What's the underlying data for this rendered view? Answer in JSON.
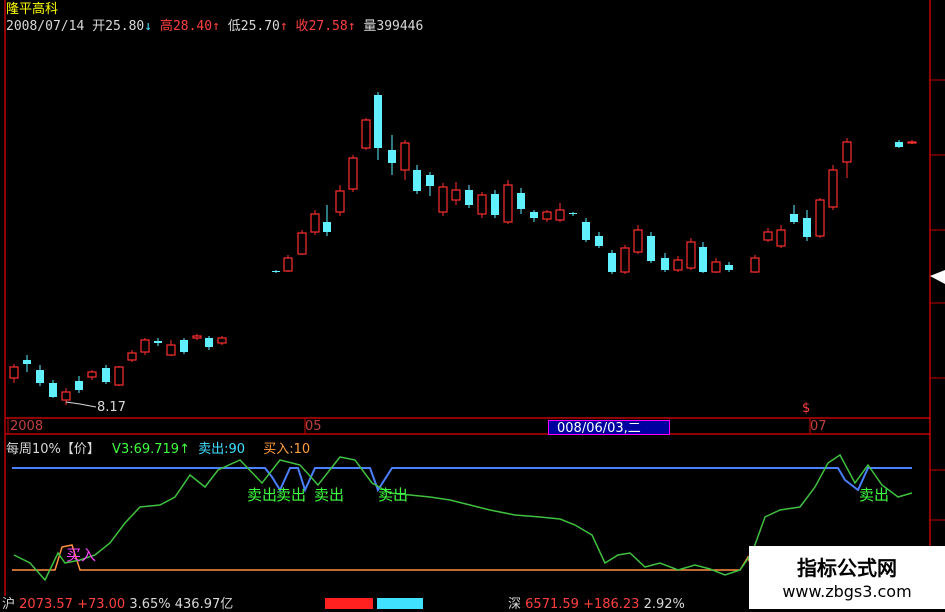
{
  "stock": {
    "name": "隆平高科"
  },
  "quote": {
    "date": "2008/07/14",
    "open_label": "开",
    "open_value": "25.80",
    "open_arrow": "↓",
    "high_label": "高",
    "high_value": "28.40",
    "high_arrow": "↑",
    "low_label": "低",
    "low_value": "25.70",
    "low_arrow": "↑",
    "close_label": "收",
    "close_value": "27.58",
    "close_arrow": "↑",
    "volume_label": "量",
    "volume_value": "399446"
  },
  "price_chart": {
    "low_marker": "8.17",
    "x_labels": [
      "2008",
      "05",
      "07"
    ],
    "cursor_date": "008/06/03,二",
    "dollar_marker": "$"
  },
  "indicator": {
    "name": "每周10%【价】",
    "v3_label": "V3:",
    "v3_value": "69.719",
    "v3_arrow": "↑",
    "sell_label": "卖出:",
    "sell_value": "90",
    "buy_label": "买入:",
    "buy_value": "10",
    "sell_signal": "卖出",
    "buy_signal": "买入"
  },
  "status_bar": {
    "sh_name": "沪",
    "sh_index": "2073.57",
    "sh_change": "+73.00",
    "sh_pct": "3.65%",
    "sh_amount": "436.97亿",
    "sz_name": "深",
    "sz_index": "6571.59",
    "sz_change": "+186.23",
    "sz_pct": "2.92%"
  },
  "watermark": {
    "title": "指标公式网",
    "url": "www.zbgs3.com"
  },
  "colors": {
    "up": "#ff3030",
    "down": "#60f0ff",
    "indicator": "#40c040",
    "sell_line": "#4a7fff",
    "buy_line": "#ff9040",
    "frame": "#c00000"
  }
}
